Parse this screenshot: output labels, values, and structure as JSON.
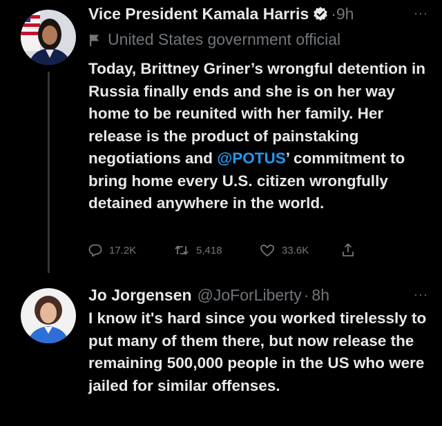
{
  "tweets": [
    {
      "display_name": "Vice President Kamala Harris",
      "dot": "·",
      "time": "9h",
      "more": "···",
      "government_label": "United States government official",
      "text_before_mention": "Today, Brittney Griner’s wrongful detention in Russia finally ends and she is on her way home to be reunited with her family. Her release is the product of painstaking negotiations and ",
      "mention": "@POTUS",
      "text_after_mention": "’ commitment to bring home every U.S. citizen wrongfully detained anywhere in the world.",
      "replies": "17.2K",
      "retweets": "5,418",
      "likes": "33.6K"
    },
    {
      "display_name": "Jo Jorgensen",
      "handle": "@JoForLiberty",
      "dot": "·",
      "time": "8h",
      "more": "···",
      "text": "I know it's hard since you worked tirelessly to put many of them there, but now release the remaining 500,000 people in the US who were jailed for similar offenses."
    }
  ],
  "colors": {
    "background": "#000000",
    "text": "#e7e9ea",
    "secondary": "#71767b",
    "link": "#1d9bf0",
    "verified_badge": "#e7e9ea",
    "thread_line": "#333639"
  },
  "icons": {
    "verified": "verified-badge-icon",
    "government": "flag-icon",
    "reply": "reply-icon",
    "retweet": "retweet-icon",
    "like": "heart-icon",
    "share": "share-icon",
    "more": "more-options-icon"
  }
}
